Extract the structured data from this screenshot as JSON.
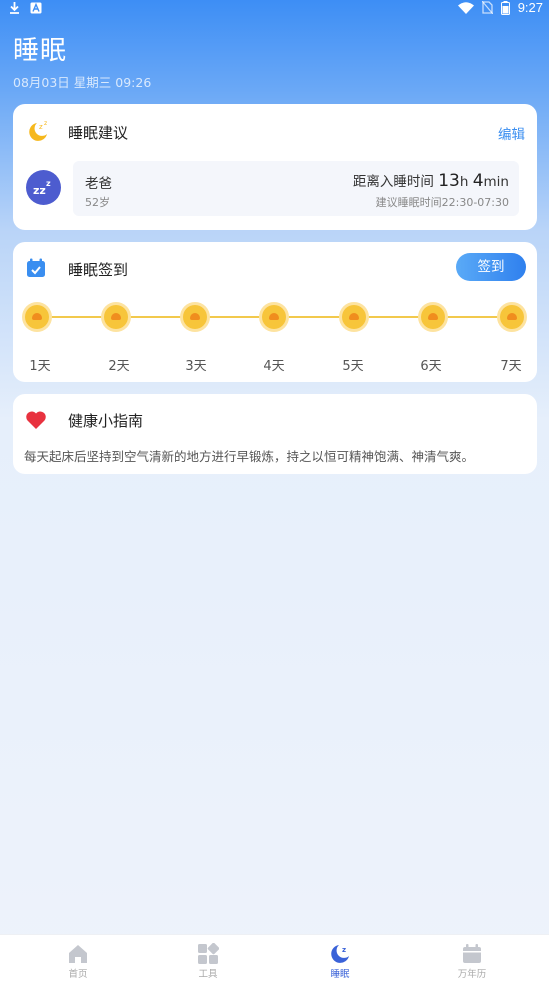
{
  "status_bar": {
    "time": "9:27"
  },
  "header": {
    "title": "睡眠",
    "datetime": "08月03日 星期三 09:26"
  },
  "advice": {
    "title": "睡眠建议",
    "edit_label": "编辑",
    "person": {
      "name": "老爸",
      "age": "52岁",
      "distance_prefix": "距离入睡时间",
      "hours": "13",
      "hours_unit": "h",
      "minutes": "4",
      "minutes_unit": "min",
      "recommended": "建议睡眠时间22:30-07:30"
    }
  },
  "checkin": {
    "title": "睡眠签到",
    "button_label": "签到",
    "days": [
      "1天",
      "2天",
      "3天",
      "4天",
      "5天",
      "6天",
      "7天"
    ]
  },
  "health": {
    "title": "健康小指南",
    "tip": "每天起床后坚持到空气清新的地方进行早锻炼，持之以恒可精神饱满、神清气爽。"
  },
  "nav": {
    "items": [
      {
        "label": "首页",
        "icon": "home-icon",
        "active": false
      },
      {
        "label": "工具",
        "icon": "tools-icon",
        "active": false
      },
      {
        "label": "睡眠",
        "icon": "moon-icon",
        "active": true
      },
      {
        "label": "万年历",
        "icon": "calendar-icon",
        "active": false
      }
    ]
  },
  "colors": {
    "accent": "#3a8ef0",
    "active_nav": "#3a62d8",
    "coin": "#f7c53a"
  }
}
